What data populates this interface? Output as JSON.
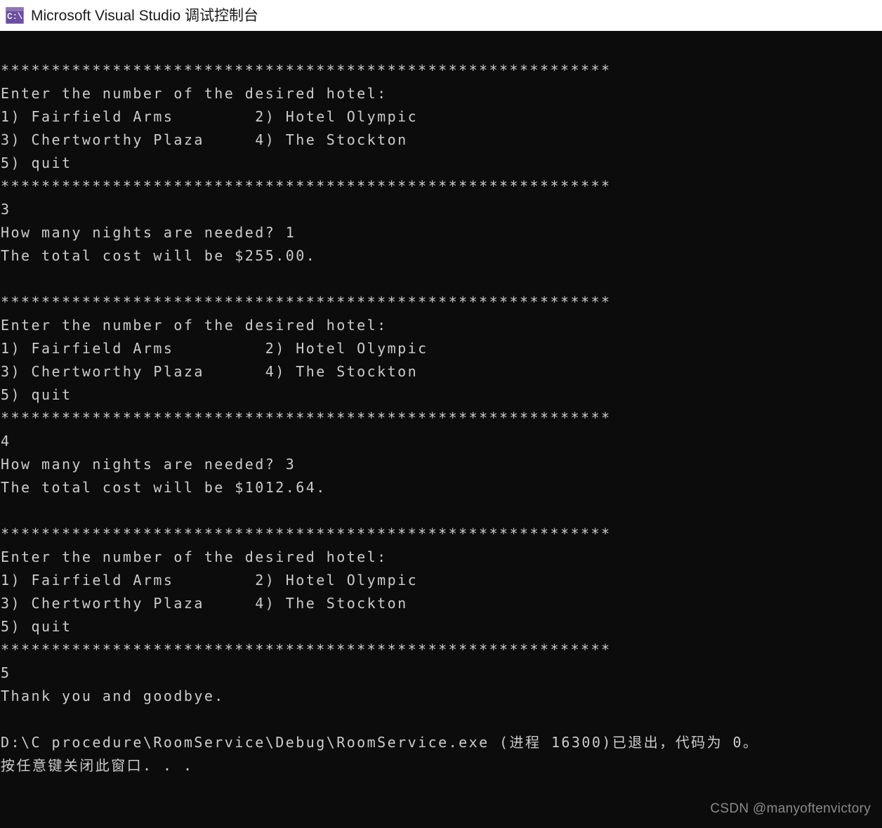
{
  "window": {
    "title": "Microsoft Visual Studio 调试控制台",
    "icon": "console-cmd-icon",
    "icon_glyph": "C:\\",
    "titlebar_background": "#ffffff",
    "titlebar_text_color": "#1b1b1b"
  },
  "console": {
    "background": "#0c0c0c",
    "foreground": "#cccccc",
    "separator": "************************************************************",
    "lines": [
      "************************************************************",
      "Enter the number of the desired hotel:",
      "1) Fairfield Arms        2) Hotel Olympic",
      "3) Chertworthy Plaza     4) The Stockton",
      "5) quit",
      "************************************************************",
      "3",
      "How many nights are needed? 1",
      "The total cost will be $255.00.",
      "",
      "************************************************************",
      "Enter the number of the desired hotel:",
      "1) Fairfield Arms         2) Hotel Olympic",
      "3) Chertworthy Plaza      4) The Stockton",
      "5) quit",
      "************************************************************",
      "4",
      "How many nights are needed? 3",
      "The total cost will be $1012.64.",
      "",
      "************************************************************",
      "Enter the number of the desired hotel:",
      "1) Fairfield Arms        2) Hotel Olympic",
      "3) Chertworthy Plaza     4) The Stockton",
      "5) quit",
      "************************************************************",
      "5",
      "Thank you and goodbye.",
      "",
      "D:\\C procedure\\RoomService\\Debug\\RoomService.exe (进程 16300)已退出，代码为 0。",
      "按任意键关闭此窗口. . ."
    ],
    "program": {
      "menu_prompt": "Enter the number of the desired hotel:",
      "menu_options": [
        "1) Fairfield Arms",
        "2) Hotel Olympic",
        "3) Chertworthy Plaza",
        "4) The Stockton",
        "5) quit"
      ],
      "nights_prompt": "How many nights are needed?",
      "total_cost_prefix": "The total cost will be",
      "goodbye_message": "Thank you and goodbye.",
      "sessions": [
        {
          "hotel_choice": "3",
          "nights": "1",
          "total_cost": "$255.00."
        },
        {
          "hotel_choice": "4",
          "nights": "3",
          "total_cost": "$1012.64."
        },
        {
          "hotel_choice": "5",
          "nights": "",
          "total_cost": ""
        }
      ]
    },
    "exit_message": "D:\\C procedure\\RoomService\\Debug\\RoomService.exe (进程 16300)已退出，代码为 0。",
    "close_prompt": "按任意键关闭此窗口. . .",
    "exit_code": "0",
    "process_id": "16300",
    "executable_path": "D:\\C procedure\\RoomService\\Debug\\RoomService.exe"
  },
  "watermark": {
    "text": "CSDN @manyoftenvictory",
    "color": "#8a8a8a"
  }
}
